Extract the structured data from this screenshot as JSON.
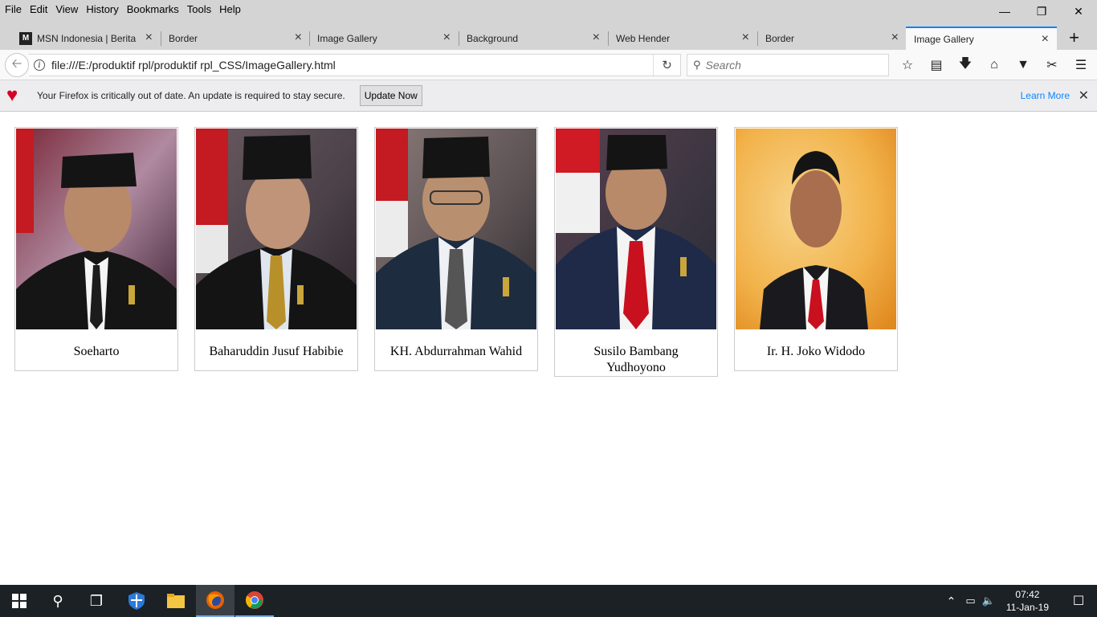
{
  "menu": [
    "File",
    "Edit",
    "View",
    "History",
    "Bookmarks",
    "Tools",
    "Help"
  ],
  "tabs": [
    {
      "label": "MSN Indonesia | Berita T",
      "favicon": "M"
    },
    {
      "label": "Border"
    },
    {
      "label": "Image Gallery"
    },
    {
      "label": "Background"
    },
    {
      "label": "Web Hender"
    },
    {
      "label": "Border"
    },
    {
      "label": "Image Gallery",
      "active": true
    }
  ],
  "address": {
    "url": "file:///E:/produktif rpl/produktif rpl_CSS/ImageGallery.html"
  },
  "search": {
    "placeholder": "Search"
  },
  "notification": {
    "message": "Your Firefox is critically out of date. An update is required to stay secure.",
    "update_button": "Update Now",
    "learn_more": "Learn More"
  },
  "gallery": [
    {
      "caption": "Soeharto",
      "bg": "#5a2e3a"
    },
    {
      "caption": "Baharuddin Jusuf Habibie",
      "bg": "#4b4348"
    },
    {
      "caption": "KH. Abdurrahman Wahid",
      "bg": "#5a5052"
    },
    {
      "caption": "Susilo Bambang Yudhoyono",
      "bg": "#3a3540"
    },
    {
      "caption": "Ir. H. Joko Widodo",
      "bg": "#f2b24a"
    }
  ],
  "taskbar": {
    "time": "07:42",
    "date": "11-Jan-19"
  },
  "colors": {
    "accent": "#0a84ff",
    "alert": "#d70022"
  }
}
